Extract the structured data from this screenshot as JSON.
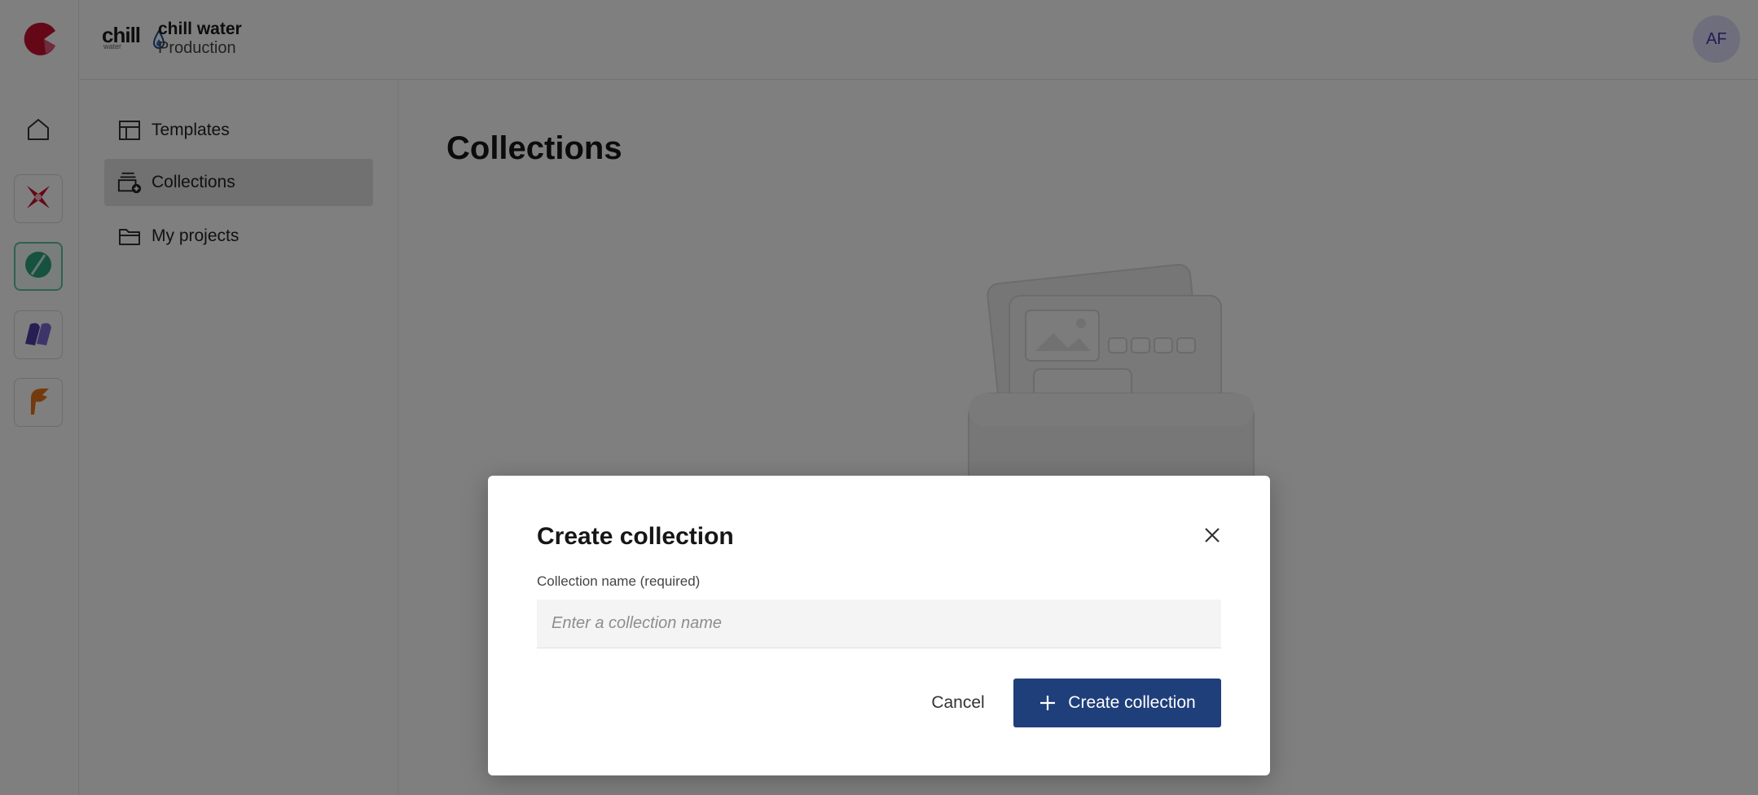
{
  "header": {
    "org_logo_text": "chill",
    "org_logo_sub": "water",
    "org_name": "chill water",
    "environment": "Production",
    "avatar_initials": "AF"
  },
  "rail": {
    "items": [
      {
        "name": "home",
        "icon": "home-icon"
      },
      {
        "name": "app-star",
        "icon": "star-burst-app-icon"
      },
      {
        "name": "app-leaf",
        "icon": "leaf-app-icon",
        "active": true
      },
      {
        "name": "app-book",
        "icon": "book-app-icon"
      },
      {
        "name": "app-feather",
        "icon": "feather-app-icon"
      }
    ]
  },
  "sidebar": {
    "items": [
      {
        "label": "Templates",
        "icon": "template-icon"
      },
      {
        "label": "Collections",
        "icon": "collections-icon",
        "selected": true
      },
      {
        "label": "My projects",
        "icon": "folder-icon"
      }
    ]
  },
  "main": {
    "title": "Collections"
  },
  "modal": {
    "title": "Create collection",
    "field_label": "Collection name (required)",
    "field_placeholder": "Enter a collection name",
    "field_value": "",
    "cancel_label": "Cancel",
    "create_label": "Create collection"
  },
  "colors": {
    "primary": "#1f3f7a",
    "rail_active": "#5fc3a9",
    "brand_red": "#c8102e",
    "avatar_bg": "#dcdcf8"
  }
}
